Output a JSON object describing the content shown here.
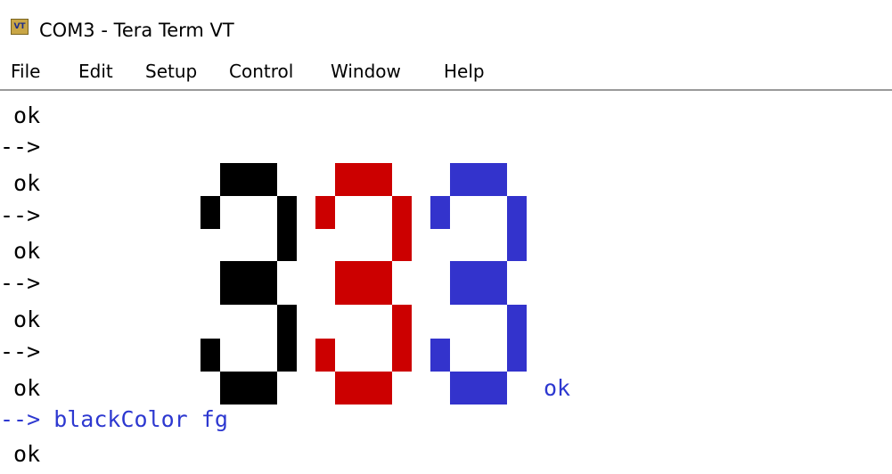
{
  "window": {
    "icon_text": "VT",
    "title": "COM3 - Tera Term VT"
  },
  "menu": {
    "file": "File",
    "edit": "Edit",
    "setup": "Setup",
    "control": "Control",
    "window": "Window",
    "help": "Help"
  },
  "terminal": {
    "lines": [
      " ok",
      "-->",
      " ok",
      "-->",
      " ok",
      "-->",
      " ok",
      "-->",
      " ok",
      "--> blackColor fg",
      " ok"
    ],
    "inline_ok": "ok",
    "text_color": "#000000",
    "prompt_color": "#2d38d0"
  },
  "big_digits": [
    {
      "char": "3",
      "color": "#000000"
    },
    {
      "char": "3",
      "color": "#cc0000"
    },
    {
      "char": "3",
      "color": "#3333cc"
    }
  ],
  "colors": {
    "black": "#000000",
    "red": "#cc0000",
    "blue": "#3333cc"
  }
}
